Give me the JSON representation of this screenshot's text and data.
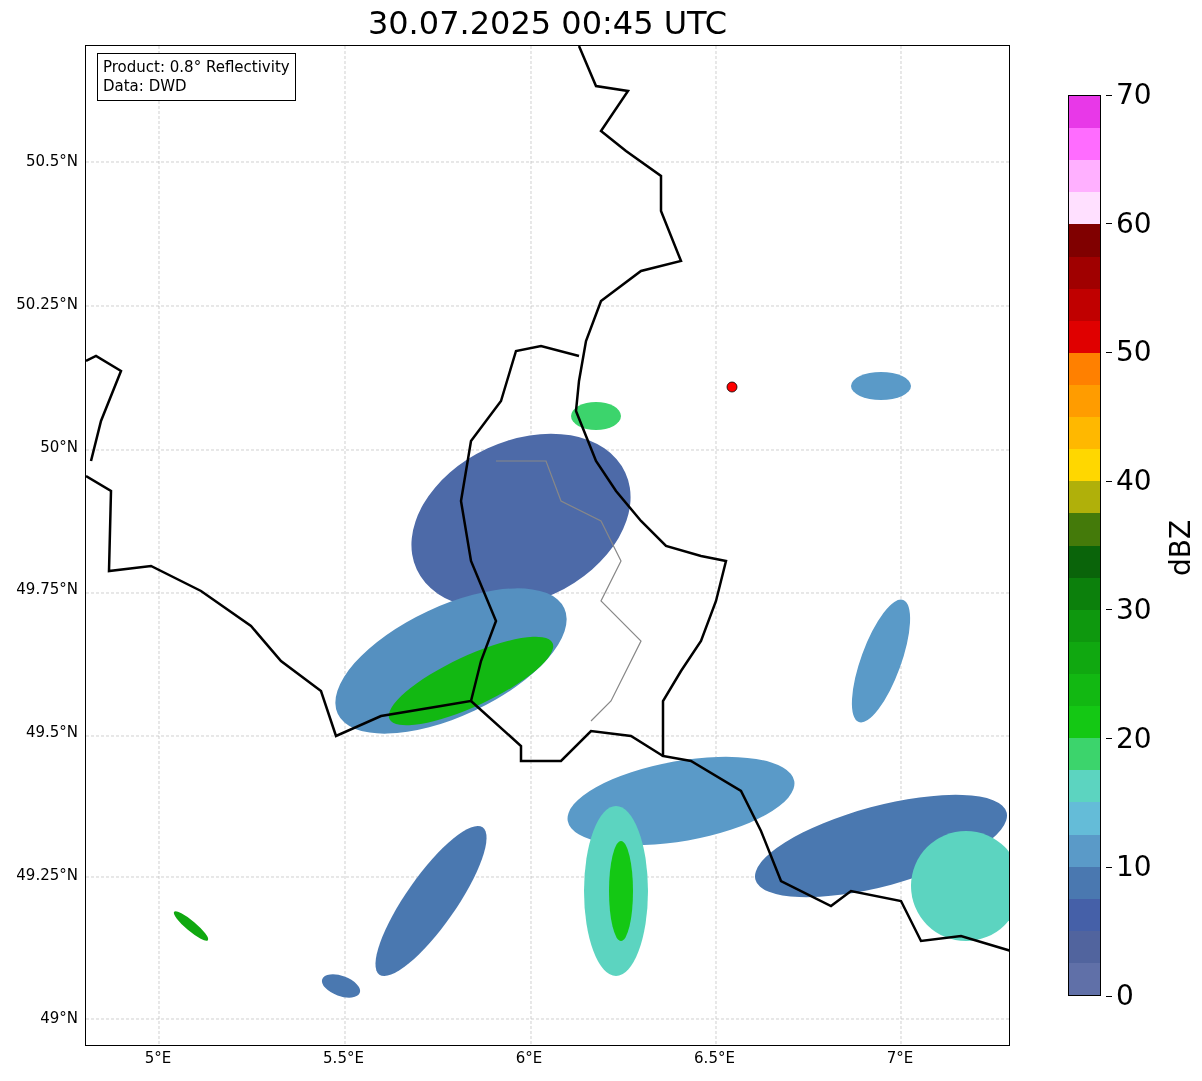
{
  "title": "30.07.2025 00:45 UTC",
  "info_box": [
    "Product: 0.8° Reflectivity",
    "Data: DWD"
  ],
  "y_axis_labels": [
    "50.5°N",
    "50.25°N",
    "50°N",
    "49.75°N",
    "49.5°N",
    "49.25°N",
    "49°N"
  ],
  "x_axis_labels": [
    "5°E",
    "5.5°E",
    "6°E",
    "6.5°E",
    "7°E"
  ],
  "colorbar": {
    "label": "dBZ",
    "ticks": [
      "70",
      "60",
      "50",
      "40",
      "30",
      "20",
      "10",
      "0"
    ],
    "segments": [
      {
        "color": "#e838e8"
      },
      {
        "color": "#ff6cff"
      },
      {
        "color": "#ffb0ff"
      },
      {
        "color": "#ffe0ff"
      },
      {
        "color": "#800000"
      },
      {
        "color": "#a00000"
      },
      {
        "color": "#c00000"
      },
      {
        "color": "#e00000"
      },
      {
        "color": "#ff8000"
      },
      {
        "color": "#ff9c00"
      },
      {
        "color": "#ffb800"
      },
      {
        "color": "#ffd700"
      },
      {
        "color": "#b0b00a"
      },
      {
        "color": "#447a0a"
      },
      {
        "color": "#0a640a"
      },
      {
        "color": "#0c800c"
      },
      {
        "color": "#0e980e"
      },
      {
        "color": "#10a810"
      },
      {
        "color": "#12b812"
      },
      {
        "color": "#14c814"
      },
      {
        "color": "#3cd46c"
      },
      {
        "color": "#5cd4c0"
      },
      {
        "color": "#64bcd8"
      },
      {
        "color": "#5a9ac8"
      },
      {
        "color": "#4a78b0"
      },
      {
        "color": "#4560a8"
      },
      {
        "color": "#51649e"
      },
      {
        "color": "#6070a8"
      }
    ]
  }
}
